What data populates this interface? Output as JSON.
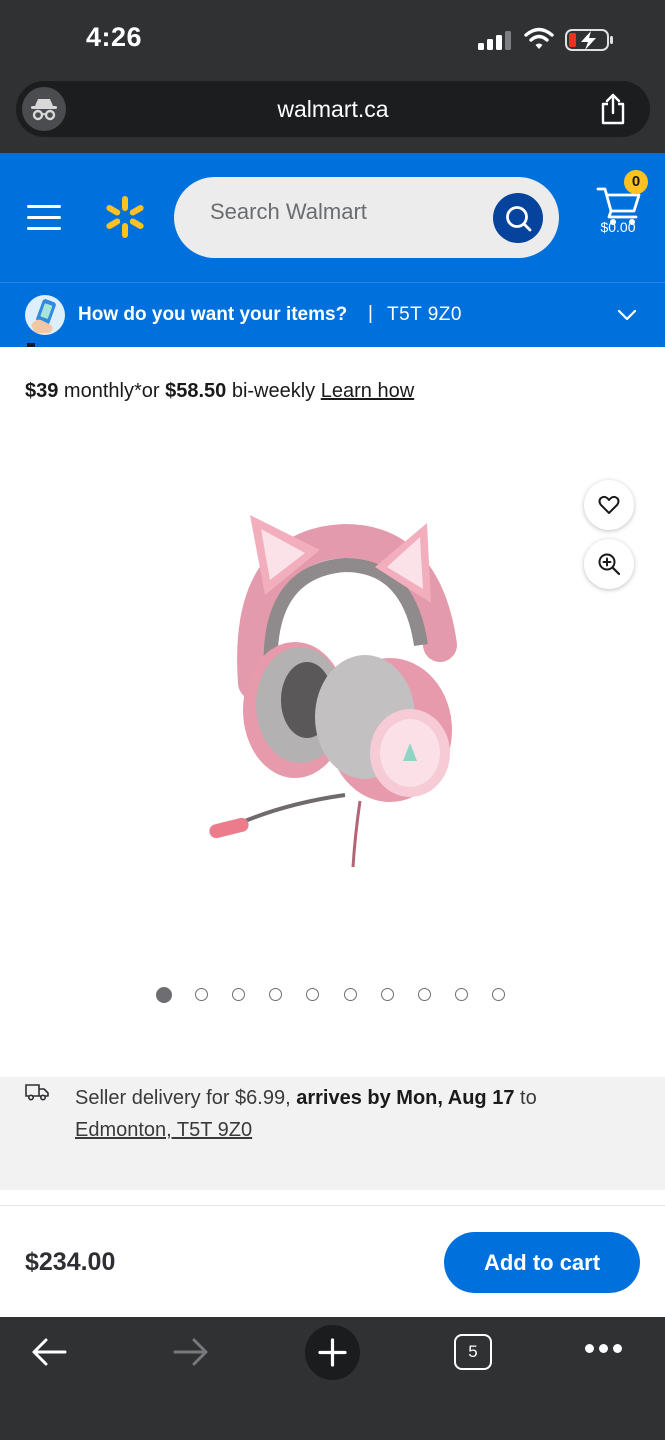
{
  "status_bar": {
    "time": "4:26"
  },
  "browser": {
    "url": "walmart.ca",
    "open_tabs": "5"
  },
  "header": {
    "search_placeholder": "Search Walmart",
    "cart_count": "0",
    "cart_total": "$0.00",
    "brand_color": "#0071dc",
    "spark_color": "#ffc220"
  },
  "fulfillment": {
    "question": "How do you want your items?",
    "separator": "|",
    "postal_code": "T5T 9Z0"
  },
  "financing": {
    "monthly_amount": "$39",
    "monthly_suffix": " monthly*or ",
    "biweekly_amount": "$58.50",
    "biweekly_suffix": " bi-weekly ",
    "learn_link": "Learn how"
  },
  "gallery": {
    "image_count": 10,
    "active_index": 0
  },
  "delivery": {
    "prefix": "Seller delivery for $6.99, ",
    "arrival": "arrives by Mon, Aug 17",
    "suffix": " to",
    "location": "Edmonton, T5T 9Z0"
  },
  "sticky_bar": {
    "price": "$234.00",
    "add_to_cart_label": "Add to cart"
  }
}
